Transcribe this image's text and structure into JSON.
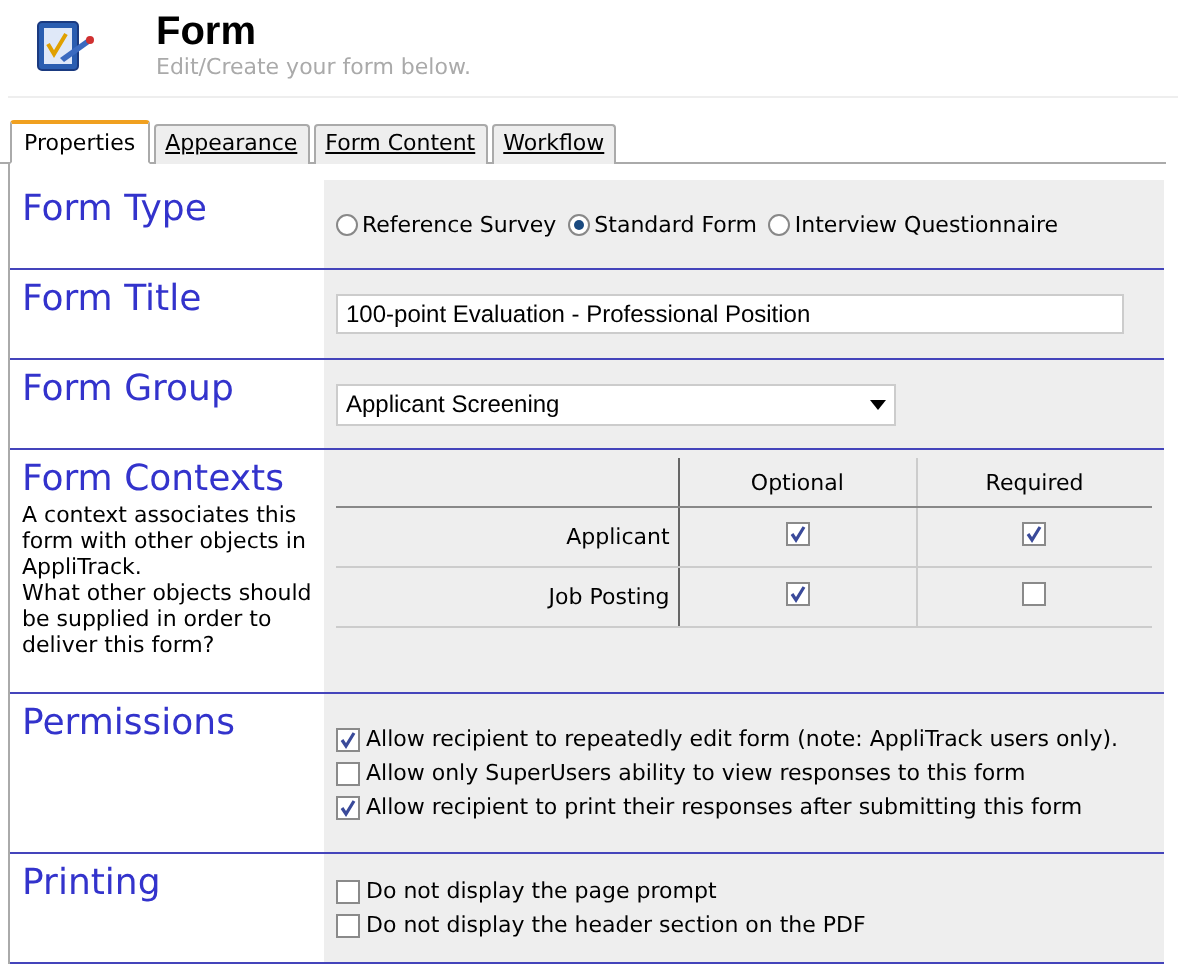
{
  "header": {
    "title": "Form",
    "subtitle": "Edit/Create your form below."
  },
  "tabs": [
    {
      "label": "Properties",
      "selected": true
    },
    {
      "label": "Appearance",
      "selected": false
    },
    {
      "label": "Form Content",
      "selected": false
    },
    {
      "label": "Workflow",
      "selected": false
    }
  ],
  "sections": [
    {
      "kind": "radio",
      "label": "Form Type",
      "options": [
        {
          "label": "Reference Survey",
          "selected": false
        },
        {
          "label": "Standard Form",
          "selected": true
        },
        {
          "label": "Interview Questionnaire",
          "selected": false
        }
      ]
    },
    {
      "kind": "text",
      "label": "Form Title",
      "value": "100-point Evaluation - Professional Position"
    },
    {
      "kind": "select",
      "label": "Form Group",
      "value": "Applicant Screening"
    },
    {
      "kind": "matrix",
      "label": "Form Contexts",
      "description": [
        "A context associates this form with other objects in AppliTrack.",
        "What other objects should be supplied in order to deliver this form?"
      ],
      "columns": [
        "Optional",
        "Required"
      ],
      "rows": [
        {
          "label": "Applicant",
          "cells": [
            {
              "checked": true
            },
            {
              "checked": true
            }
          ]
        },
        {
          "label": "Job Posting",
          "cells": [
            {
              "checked": true
            },
            {
              "checked": false
            }
          ]
        }
      ]
    },
    {
      "kind": "checks",
      "label": "Permissions",
      "items": [
        {
          "label": "Allow recipient to repeatedly edit form (note: AppliTrack users only).",
          "checked": true
        },
        {
          "label": "Allow only SuperUsers ability to view responses to this form",
          "checked": false
        },
        {
          "label": "Allow recipient to print their responses after submitting this form",
          "checked": true
        }
      ]
    },
    {
      "kind": "checks",
      "label": "Printing",
      "items": [
        {
          "label": "Do not display the page prompt",
          "checked": false
        },
        {
          "label": "Do not display the header section on the PDF",
          "checked": false
        }
      ]
    }
  ]
}
